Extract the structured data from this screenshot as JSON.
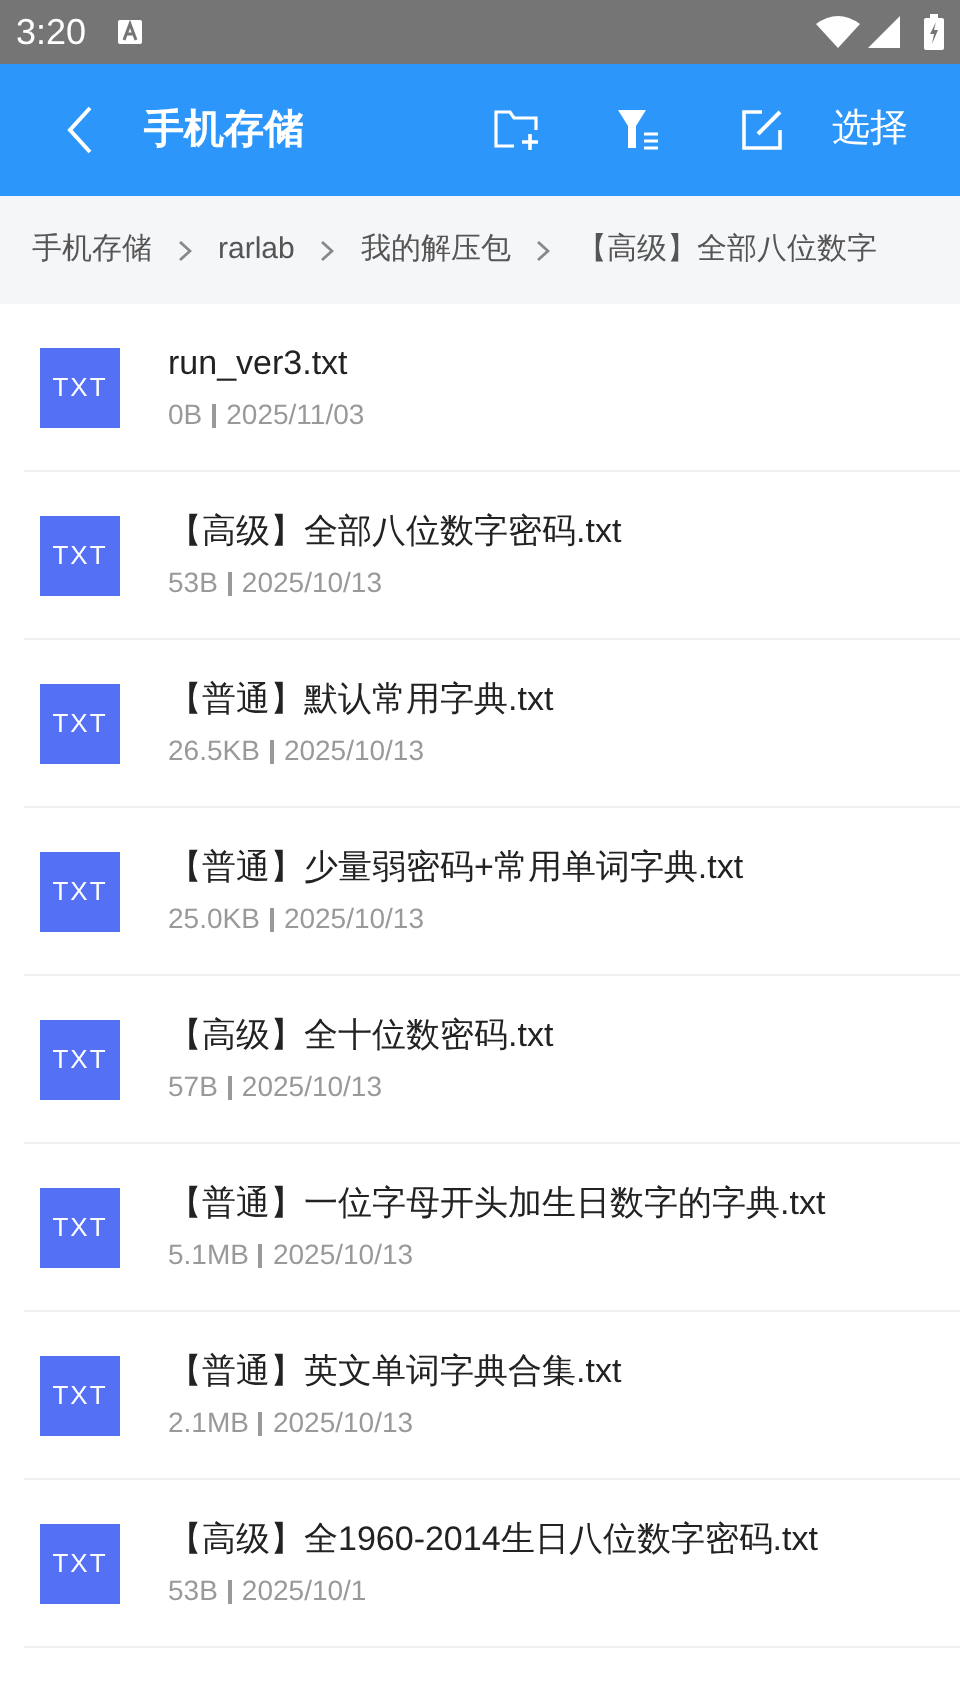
{
  "status_bar": {
    "time": "3:20"
  },
  "toolbar": {
    "title": "手机存储",
    "select": "选择"
  },
  "breadcrumb": [
    "手机存储",
    "rarlab",
    "我的解压包",
    "【高级】全部八位数字"
  ],
  "files": [
    {
      "icon": "TXT",
      "name": "run_ver3.txt",
      "size": "0B",
      "date": "2025/11/03"
    },
    {
      "icon": "TXT",
      "name": "【高级】全部八位数字密码.txt",
      "size": "53B",
      "date": "2025/10/13"
    },
    {
      "icon": "TXT",
      "name": "【普通】默认常用字典.txt",
      "size": "26.5KB",
      "date": "2025/10/13"
    },
    {
      "icon": "TXT",
      "name": "【普通】少量弱密码+常用单词字典.txt",
      "size": "25.0KB",
      "date": "2025/10/13"
    },
    {
      "icon": "TXT",
      "name": "【高级】全十位数密码.txt",
      "size": "57B",
      "date": "2025/10/13"
    },
    {
      "icon": "TXT",
      "name": "【普通】一位字母开头加生日数字的字典.txt",
      "size": "5.1MB",
      "date": "2025/10/13"
    },
    {
      "icon": "TXT",
      "name": "【普通】英文单词字典合集.txt",
      "size": "2.1MB",
      "date": "2025/10/13"
    },
    {
      "icon": "TXT",
      "name": "【高级】全1960-2014生日八位数字密码.txt",
      "size": "53B",
      "date": "2025/10/1"
    }
  ]
}
